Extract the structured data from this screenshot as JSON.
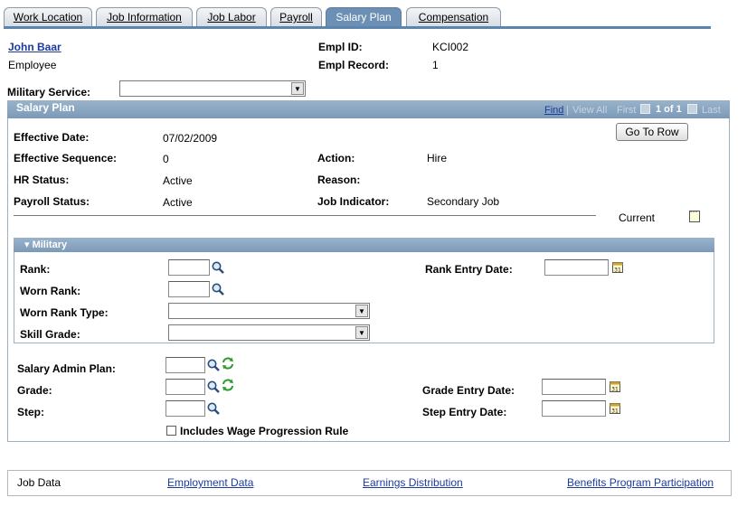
{
  "tabs": [
    {
      "label": "Work Location",
      "active": false
    },
    {
      "label": "Job Information",
      "active": false
    },
    {
      "label": "Job Labor",
      "active": false
    },
    {
      "label": "Payroll",
      "active": false
    },
    {
      "label": "Salary Plan",
      "active": true
    },
    {
      "label": "Compensation",
      "active": false
    }
  ],
  "employee": {
    "name": "John Baar",
    "role": "Employee",
    "empl_id_label": "Empl ID:",
    "empl_id": "KCI002",
    "empl_record_label": "Empl Record:",
    "empl_record": "1"
  },
  "military_service": {
    "label": "Military Service:",
    "value": ""
  },
  "salary_plan": {
    "title": "Salary Plan",
    "nav": {
      "find": "Find",
      "view_all": "View All",
      "first": "First",
      "counter": "1 of 1",
      "last": "Last",
      "separator": "|"
    },
    "go_to_row": "Go To Row",
    "effective_date_label": "Effective Date:",
    "effective_date": "07/02/2009",
    "effective_sequence_label": "Effective Sequence:",
    "effective_sequence": "0",
    "action_label": "Action:",
    "action": "Hire",
    "hr_status_label": "HR Status:",
    "hr_status": "Active",
    "reason_label": "Reason:",
    "reason": "",
    "payroll_status_label": "Payroll Status:",
    "payroll_status": "Active",
    "job_indicator_label": "Job Indicator:",
    "job_indicator": "Secondary Job",
    "current_label": "Current"
  },
  "military": {
    "title": "Military",
    "rank_label": "Rank:",
    "rank": "",
    "rank_entry_date_label": "Rank Entry Date:",
    "rank_entry_date": "",
    "worn_rank_label": "Worn Rank:",
    "worn_rank": "",
    "worn_rank_type_label": "Worn Rank Type:",
    "worn_rank_type": "",
    "skill_grade_label": "Skill Grade:",
    "skill_grade": ""
  },
  "salary_admin": {
    "salary_admin_plan_label": "Salary Admin Plan:",
    "salary_admin_plan": "",
    "grade_label": "Grade:",
    "grade": "",
    "grade_entry_date_label": "Grade Entry Date:",
    "grade_entry_date": "",
    "step_label": "Step:",
    "step": "",
    "step_entry_date_label": "Step Entry Date:",
    "step_entry_date": "",
    "wage_progression_label": "Includes Wage Progression Rule",
    "wage_progression_checked": false
  },
  "footer": {
    "job_data": "Job Data",
    "employment_data": "Employment Data",
    "earnings_distribution": "Earnings Distribution",
    "benefits_program": "Benefits Program Participation"
  },
  "icons": {
    "lookup": "magnifier-icon",
    "refresh": "green-refresh-icon",
    "calendar": "calendar-icon",
    "notepad": "notepad-icon",
    "dropdown": "chevron-down-icon"
  },
  "colors": {
    "tab_active": "#6b90b3",
    "panel_header": "#7b9ab8",
    "link": "#1d3b9d"
  }
}
